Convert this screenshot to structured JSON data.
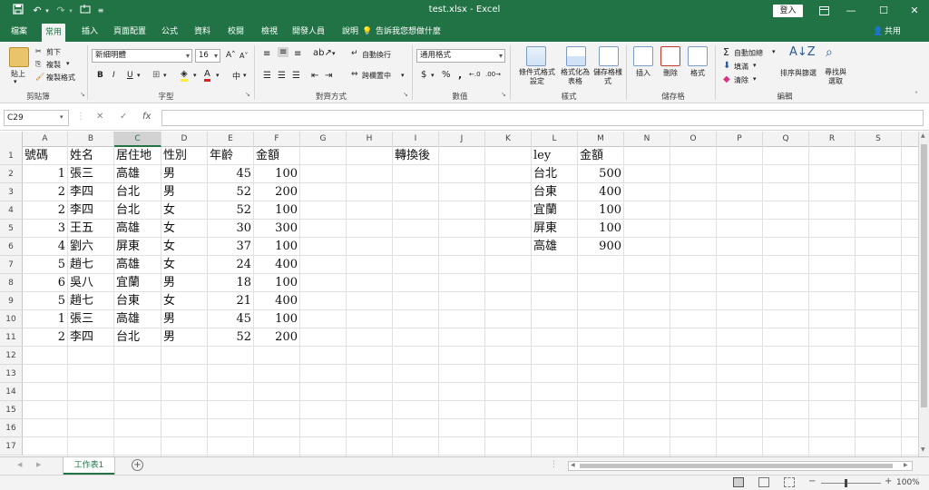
{
  "app": {
    "title": "test.xlsx  -  Excel",
    "signin": "登入",
    "share": "共用",
    "tell_me": "告訴我您想做什麼"
  },
  "tabs": [
    "檔案",
    "常用",
    "插入",
    "頁面配置",
    "公式",
    "資料",
    "校閱",
    "檢視",
    "開發人員",
    "說明"
  ],
  "active_tab": "常用",
  "ribbon": {
    "clipboard": {
      "label": "剪貼簿",
      "paste": "貼上",
      "cut": "剪下",
      "copy": "複製",
      "format_painter": "複製格式"
    },
    "font": {
      "label": "字型",
      "font_name": "新細明體",
      "font_size": "16",
      "bold": "B",
      "italic": "I",
      "underline": "U"
    },
    "alignment": {
      "label": "對齊方式",
      "wrap": "自動換行",
      "merge": "跨欄置中"
    },
    "number": {
      "label": "數值",
      "format": "通用格式",
      "currency": "$",
      "percent": "%",
      "comma": ","
    },
    "styles": {
      "label": "樣式",
      "conditional": "條件式格式設定",
      "as_table": "格式化為表格",
      "cell_styles": "儲存格樣式"
    },
    "cells": {
      "label": "儲存格",
      "insert": "插入",
      "delete": "刪除",
      "format": "格式"
    },
    "editing": {
      "label": "編輯",
      "autosum": "自動加總",
      "fill": "填滿",
      "clear": "清除",
      "sort_filter": "排序與篩選",
      "find_select": "尋找與選取"
    }
  },
  "formula_bar": {
    "name_box": "C29",
    "fx": "fx",
    "value": ""
  },
  "columns": [
    "A",
    "B",
    "C",
    "D",
    "E",
    "F",
    "G",
    "H",
    "I",
    "J",
    "K",
    "L",
    "M",
    "N",
    "O",
    "P",
    "Q",
    "R",
    "S"
  ],
  "selected_column": "C",
  "rows": [
    "1",
    "2",
    "3",
    "4",
    "5",
    "6",
    "7",
    "8",
    "9",
    "10",
    "11",
    "12",
    "13",
    "14",
    "15",
    "16",
    "17"
  ],
  "sheet": {
    "A": [
      "號碼",
      "1",
      "2",
      "2",
      "3",
      "4",
      "5",
      "6",
      "5",
      "1",
      "2"
    ],
    "B": [
      "姓名",
      "張三",
      "李四",
      "李四",
      "王五",
      "劉六",
      "趙七",
      "吳八",
      "趙七",
      "張三",
      "李四"
    ],
    "C": [
      "居住地",
      "高雄",
      "台北",
      "台北",
      "高雄",
      "屏東",
      "高雄",
      "宜蘭",
      "台東",
      "高雄",
      "台北"
    ],
    "D": [
      "性別",
      "男",
      "男",
      "女",
      "女",
      "女",
      "女",
      "男",
      "女",
      "男",
      "男"
    ],
    "E": [
      "年齡",
      "45",
      "52",
      "52",
      "30",
      "37",
      "24",
      "18",
      "21",
      "45",
      "52"
    ],
    "F": [
      "金額",
      "100",
      "200",
      "100",
      "300",
      "100",
      "400",
      "100",
      "400",
      "100",
      "200"
    ],
    "I": [
      "轉換後"
    ],
    "L": [
      "ley",
      "台北",
      "台東",
      "宜蘭",
      "屏東",
      "高雄"
    ],
    "M": [
      "金額",
      "500",
      "400",
      "100",
      "100",
      "900"
    ]
  },
  "sheet_tab": "工作表1",
  "zoom": "100%"
}
